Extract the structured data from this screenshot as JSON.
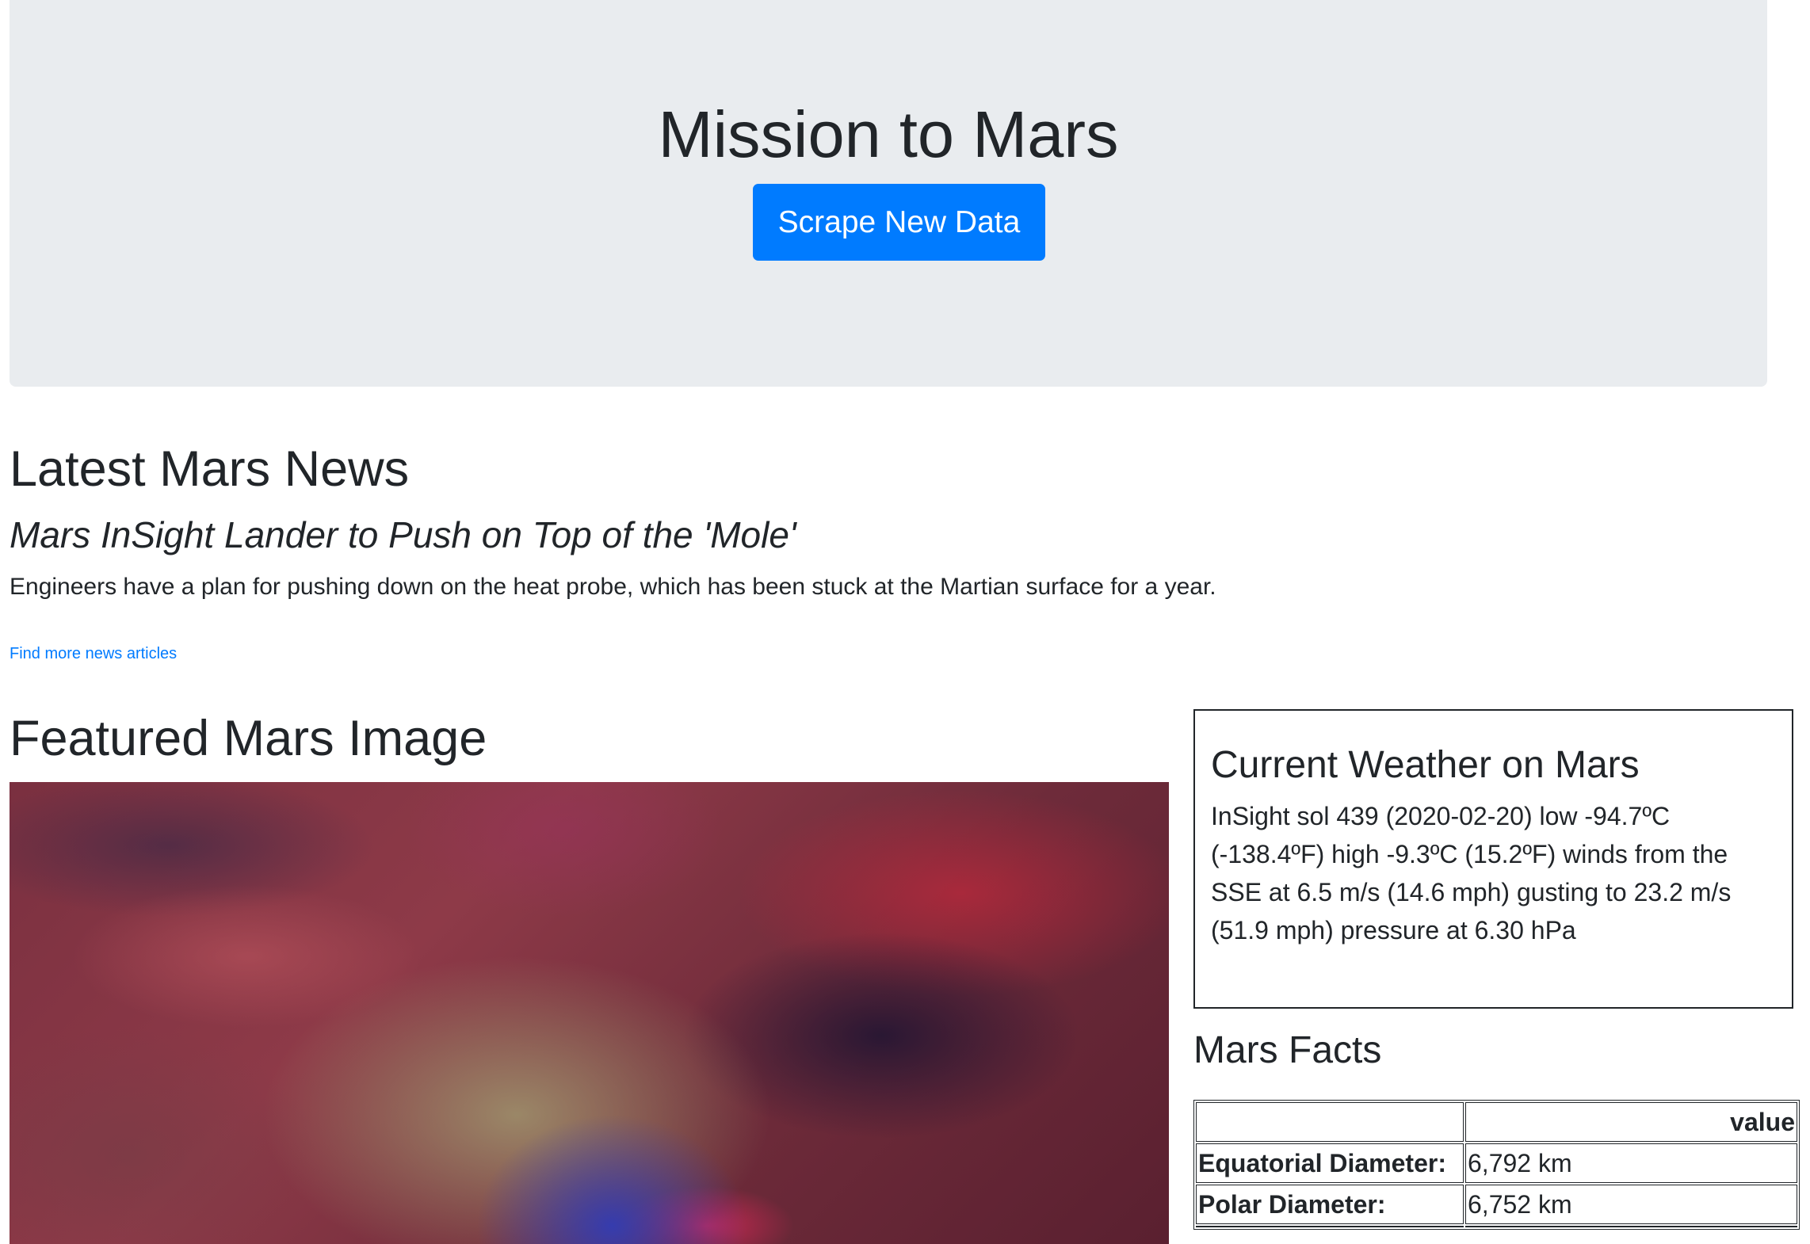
{
  "header": {
    "title": "Mission to Mars",
    "scrape_button_label": "Scrape New Data"
  },
  "news": {
    "section_title": "Latest Mars News",
    "headline": "Mars InSight Lander to Push on Top of the 'Mole'",
    "teaser": "Engineers have a plan for pushing down on the heat probe, which has been stuck at the Martian surface for a year.",
    "more_link": "Find more news articles"
  },
  "featured_image": {
    "section_title": "Featured Mars Image"
  },
  "weather": {
    "title": "Current Weather on Mars",
    "text": "InSight sol 439 (2020-02-20) low -94.7ºC (-138.4ºF) high -9.3ºC (15.2ºF) winds from the SSE at 6.5 m/s (14.6 mph) gusting to 23.2 m/s (51.9 mph) pressure at 6.30 hPa"
  },
  "facts": {
    "section_title": "Mars Facts",
    "header": [
      "",
      "value"
    ],
    "rows": [
      {
        "label": "Equatorial Diameter:",
        "value": "6,792 km"
      },
      {
        "label": "Polar Diameter:",
        "value": "6,752 km"
      },
      {
        "label": "",
        "value": ""
      }
    ]
  }
}
